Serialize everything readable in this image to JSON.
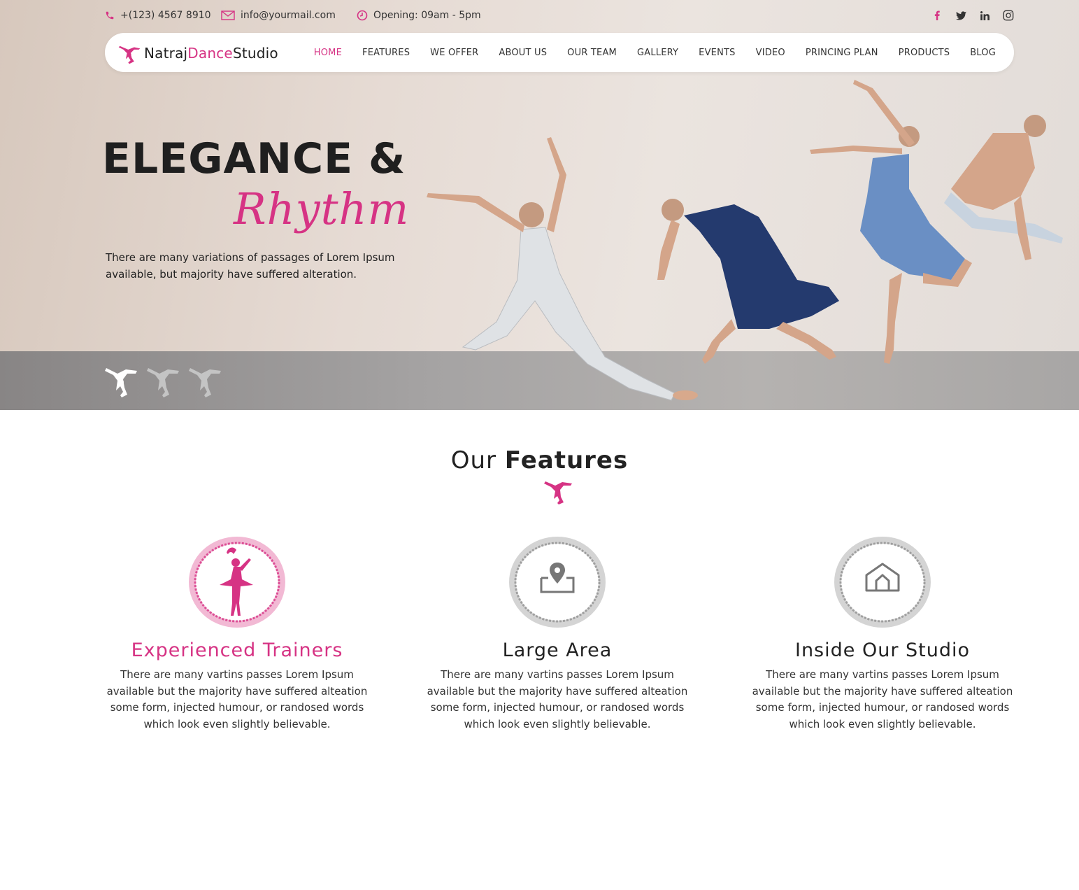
{
  "topbar": {
    "phone": "+(123) 4567 8910",
    "email": "info@yourmail.com",
    "hours": "Opening: 09am - 5pm",
    "social": [
      "facebook-icon",
      "twitter-icon",
      "linkedin-icon",
      "instagram-icon"
    ]
  },
  "logo": {
    "part1": "Natraj",
    "part2": "Dance",
    "part3": "Studio"
  },
  "nav": {
    "items": [
      "HOME",
      "FEATURES",
      "WE OFFER",
      "ABOUT US",
      "OUR TEAM",
      "GALLERY",
      "EVENTS",
      "VIDEO",
      "PRINCING PLAN",
      "PRODUCTS",
      "BLOG"
    ],
    "active": "HOME"
  },
  "hero": {
    "title": "ELEGANCE &",
    "script": "Rhythm",
    "description": "There are many variations of passages of Lorem Ipsum available, but majority have suffered alteration."
  },
  "slider": {
    "count": 3,
    "active_index": 0
  },
  "features_section": {
    "title_light": "Our",
    "title_bold": "Features",
    "items": [
      {
        "title": "Experienced Trainers",
        "icon": "ballerina-icon",
        "description": "There are many vartins passes Lorem Ipsum available but the majority have suffered alteation some form, injected humour, or randosed words which look even slightly believable."
      },
      {
        "title": "Large Area",
        "icon": "location-pin-icon",
        "description": "There are many vartins passes Lorem Ipsum available but the majority have suffered alteation some form, injected humour, or randosed words which look even slightly believable."
      },
      {
        "title": "Inside Our Studio",
        "icon": "house-icon",
        "description": "There are many vartins passes Lorem Ipsum available but the majority have suffered alteation some form, injected humour, or randosed words which look even slightly believable."
      }
    ]
  },
  "colors": {
    "accent": "#d63384",
    "text": "#222222",
    "grey_icon": "#777777"
  }
}
